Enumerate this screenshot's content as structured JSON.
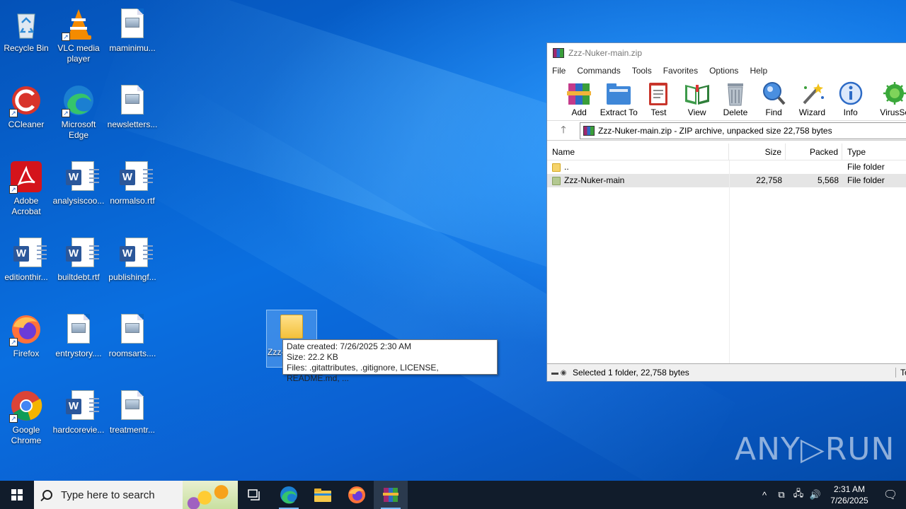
{
  "desktop": {
    "icons": [
      {
        "label": "Recycle Bin",
        "icon": "recycle-bin-icon"
      },
      {
        "label": "VLC media player",
        "icon": "vlc-icon"
      },
      {
        "label": "maminimu...",
        "icon": "image-file-icon"
      },
      {
        "label": "CCleaner",
        "icon": "ccleaner-icon"
      },
      {
        "label": "Microsoft Edge",
        "icon": "edge-icon"
      },
      {
        "label": "newsletters...",
        "icon": "image-file-icon"
      },
      {
        "label": "Adobe Acrobat",
        "icon": "acrobat-icon"
      },
      {
        "label": "analysiscoo...",
        "icon": "word-doc-icon"
      },
      {
        "label": "normalso.rtf",
        "icon": "word-doc-icon"
      },
      {
        "label": "editionthir...",
        "icon": "word-doc-icon"
      },
      {
        "label": "builtdebt.rtf",
        "icon": "word-doc-icon"
      },
      {
        "label": "publishingf...",
        "icon": "word-doc-icon"
      },
      {
        "label": "Firefox",
        "icon": "firefox-icon"
      },
      {
        "label": "entrystory....",
        "icon": "image-file-icon"
      },
      {
        "label": "roomsarts....",
        "icon": "image-file-icon"
      },
      {
        "label": "Google Chrome",
        "icon": "chrome-icon"
      },
      {
        "label": "hardcorevie...",
        "icon": "word-doc-icon"
      },
      {
        "label": "treatmentr...",
        "icon": "image-file-icon"
      }
    ],
    "drag_label": "Zzz-",
    "tooltip": {
      "line1": "Date created: 7/26/2025 2:30 AM",
      "line2": "Size: 22.2 KB",
      "line3": "Files: .gitattributes, .gitignore, LICENSE, README.md, ..."
    },
    "watermark": "ANY▷RUN"
  },
  "winrar": {
    "title": "Zzz-Nuker-main.zip",
    "menu": [
      "File",
      "Commands",
      "Tools",
      "Favorites",
      "Options",
      "Help"
    ],
    "toolbar": [
      {
        "label": "Add",
        "icon": "add-archive-icon"
      },
      {
        "label": "Extract To",
        "icon": "extract-folder-icon"
      },
      {
        "label": "Test",
        "icon": "test-clipboard-icon"
      },
      {
        "label": "View",
        "icon": "view-book-icon"
      },
      {
        "label": "Delete",
        "icon": "trash-icon"
      },
      {
        "label": "Find",
        "icon": "magnifier-icon"
      },
      {
        "label": "Wizard",
        "icon": "wand-icon"
      },
      {
        "label": "Info",
        "icon": "info-icon"
      },
      {
        "label": "VirusSc",
        "icon": "virus-scan-icon"
      }
    ],
    "address": "Zzz-Nuker-main.zip - ZIP archive, unpacked size 22,758 bytes",
    "columns": {
      "name": "Name",
      "size": "Size",
      "packed": "Packed",
      "type": "Type"
    },
    "rows": [
      {
        "name": "..",
        "size": "",
        "packed": "",
        "type": "File folder",
        "selected": false
      },
      {
        "name": "Zzz-Nuker-main",
        "size": "22,758",
        "packed": "5,568",
        "type": "File folder",
        "selected": true
      }
    ],
    "status": "Selected 1 folder, 22,758 bytes",
    "status_right": "To"
  },
  "taskbar": {
    "search_placeholder": "Type here to search",
    "time": "2:31 AM",
    "date": "7/26/2025"
  }
}
